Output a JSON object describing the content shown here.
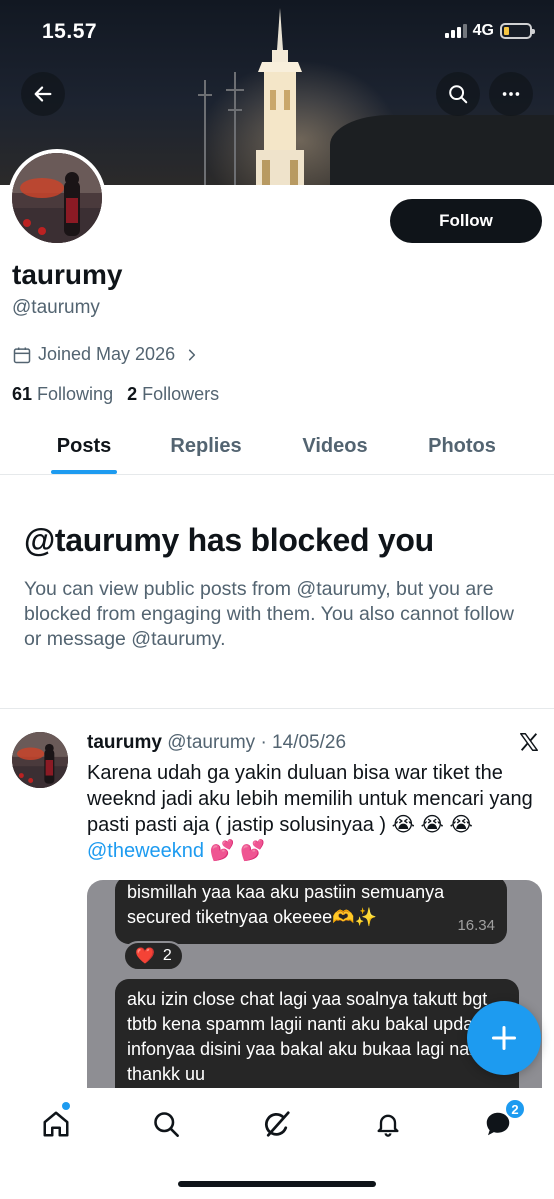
{
  "status_bar": {
    "time": "15.57",
    "network": "4G"
  },
  "profile": {
    "follow_label": "Follow",
    "display_name": "taurumy",
    "handle": "@taurumy",
    "joined": "Joined May 2026",
    "following_count": "61",
    "following_label": "Following",
    "followers_count": "2",
    "followers_label": "Followers"
  },
  "tabs": [
    {
      "label": "Posts",
      "active": true
    },
    {
      "label": "Replies",
      "active": false
    },
    {
      "label": "Videos",
      "active": false
    },
    {
      "label": "Photos",
      "active": false
    }
  ],
  "blocked": {
    "title": "@taurumy has blocked you",
    "description": "You can view public posts from @taurumy, but you are blocked from engaging with them. You also cannot follow or message @taurumy."
  },
  "post": {
    "name": "taurumy",
    "meta": "@taurumy · 14/05/26",
    "text_part1": "Karena udah ga yakin duluan bisa war tiket the weeknd jadi aku lebih memilih untuk mencari yang pasti pasti aja ( jastip solusinyaa ) 😭 😭 😭 ",
    "mention": "@theweeknd",
    "text_part2": " 💕 💕",
    "media": {
      "bubble1": "bismillah yaa kaa aku pastiin semuanya secured tiketnyaa okeeee🫶✨",
      "bubble1_time": "16.34",
      "reaction_emoji": "❤️",
      "reaction_count": "2",
      "bubble2": "aku izin close chat lagi yaa soalnya takutt bgt tbtb kena spamm lagii nanti aku bakal update infonyaa disini yaa bakal aku bukaa lagi nanti thankk uu"
    }
  },
  "nav": {
    "messages_badge": "2"
  },
  "colors": {
    "accent": "#1d9bf0",
    "text": "#0f1419",
    "muted": "#536471"
  },
  "icons": [
    "back-arrow-icon",
    "search-icon",
    "more-icon",
    "calendar-icon",
    "chevron-right-icon",
    "x-logo-icon",
    "plus-icon",
    "home-icon",
    "explore-icon",
    "grok-icon",
    "bell-icon",
    "messages-icon"
  ]
}
